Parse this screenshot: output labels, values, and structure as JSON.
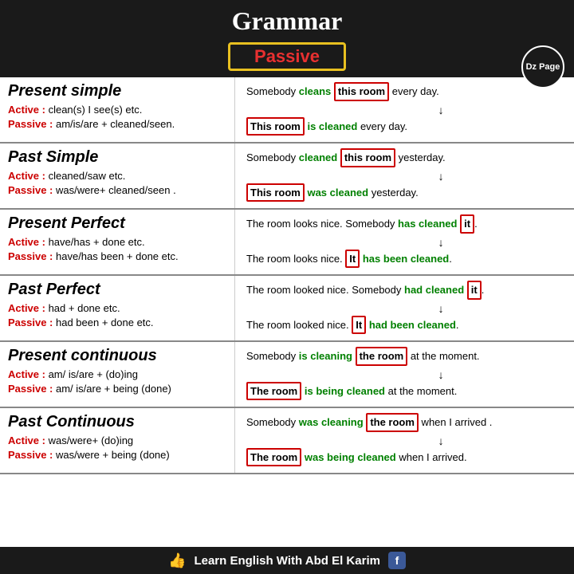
{
  "header": {
    "title": "Grammar",
    "subtitle": "Passive",
    "dz_label": "Dz Page"
  },
  "sections": [
    {
      "id": "present-simple",
      "title": "Present simple",
      "active_label": "Active :",
      "active_text": "clean(s) I see(s) etc.",
      "passive_label": "Passive :",
      "passive_text": "am/is/are + cleaned/seen.",
      "example_active": [
        "Somebody ",
        "cleans",
        " ",
        "this room",
        " every day."
      ],
      "arrow": true,
      "example_passive": [
        "",
        "This room",
        " ",
        "is cleaned",
        " every day."
      ]
    },
    {
      "id": "past-simple",
      "title": "Past Simple",
      "active_label": "Active :",
      "active_text": "cleaned/saw etc.",
      "passive_label": "Passive :",
      "passive_text": "was/were+ cleaned/seen .",
      "example_active": [
        "Somebody ",
        "cleaned",
        " ",
        "this room",
        " yesterday."
      ],
      "arrow": true,
      "example_passive": [
        "",
        "This room",
        " ",
        "was cleaned",
        " yesterday."
      ]
    },
    {
      "id": "present-perfect",
      "title": "Present Perfect",
      "active_label": "Active :",
      "active_text": "have/has + done etc.",
      "passive_label": "Passive :",
      "passive_text": "have/has been + done etc.",
      "example_active": [
        "The room looks nice. Somebody ",
        "has cleaned",
        " ",
        "it",
        "."
      ],
      "arrow": true,
      "example_passive": [
        "The room looks nice. ",
        "It",
        " ",
        "has been cleaned",
        "."
      ]
    },
    {
      "id": "past-perfect",
      "title": "Past Perfect",
      "active_label": "Active :",
      "active_text": "had + done etc.",
      "passive_label": "Passive :",
      "passive_text": "had been + done etc.",
      "example_active": [
        "The room looked nice. Somebody ",
        "had cleaned",
        " ",
        "it",
        "."
      ],
      "arrow": true,
      "example_passive": [
        "The room looked nice. ",
        "It",
        " ",
        "had been cleaned",
        "."
      ]
    },
    {
      "id": "present-continuous",
      "title": "Present continuous",
      "active_label": "Active :",
      "active_text": "am/ is/are + (do)ing",
      "passive_label": "Passive :",
      "passive_text": "am/ is/are + being (done)",
      "example_active": [
        "Somebody ",
        "is cleaning",
        " ",
        "the room",
        " at the moment."
      ],
      "arrow": true,
      "example_passive": [
        "",
        "The room",
        " ",
        "is being cleaned",
        " at the moment."
      ]
    },
    {
      "id": "past-continuous",
      "title": "Past Continuous",
      "active_label": "Active :",
      "active_text": "was/were+ (do)ing",
      "passive_label": "Passive :",
      "passive_text": "was/were + being (done)",
      "example_active": [
        "Somebody ",
        "was cleaning",
        " ",
        "the room",
        " when I arrived ."
      ],
      "arrow": true,
      "example_passive": [
        "",
        "The room",
        " ",
        "was being cleaned",
        " when I arrived."
      ]
    }
  ],
  "footer": {
    "label": "Learn English With Abd El Karim"
  }
}
